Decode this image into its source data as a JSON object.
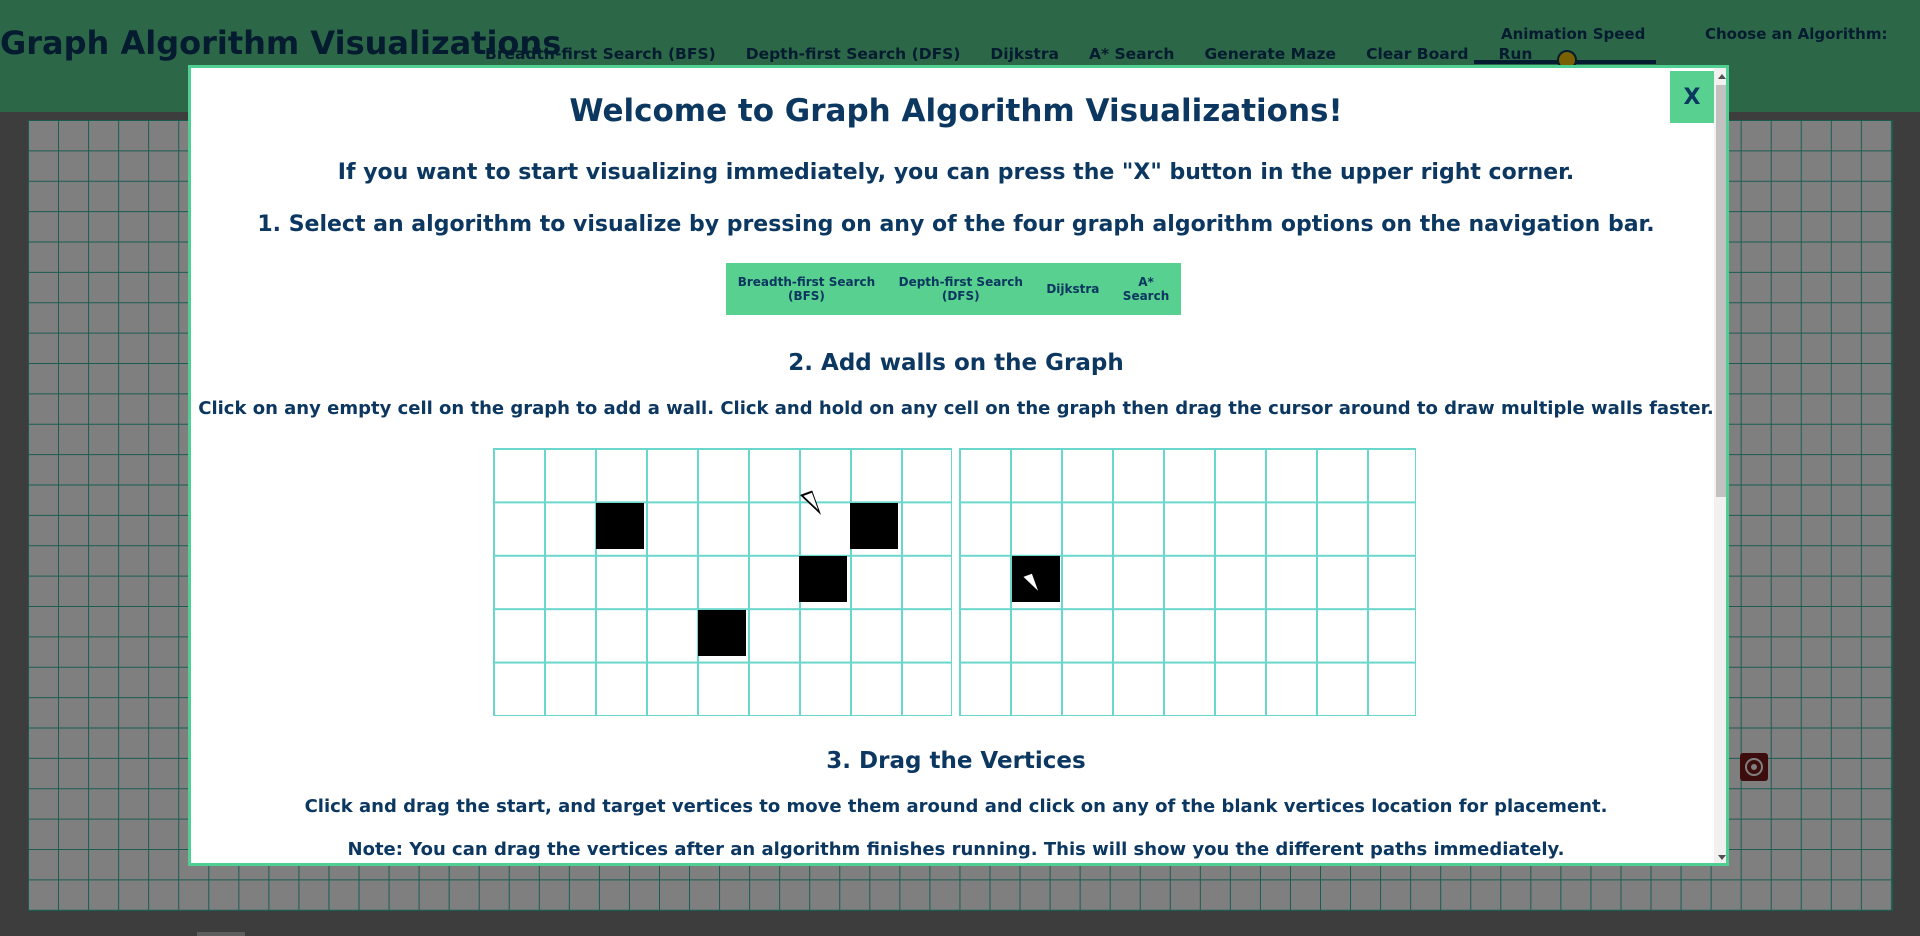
{
  "app": {
    "title": "Graph Algorithm Visualizations",
    "nav": [
      "Breadth-first Search (BFS)",
      "Depth-first Search (DFS)",
      "Dijkstra",
      "A* Search",
      "Generate Maze",
      "Clear Board",
      "Run"
    ],
    "speed_label": "Animation Speed",
    "algo_label": "Choose an Algorithm:"
  },
  "modal": {
    "close_label": "X",
    "welcome": "Welcome to Graph Algorithm Visualizations!",
    "intro": "If you want to start visualizing immediately, you can press the \"X\" button in the upper right corner.",
    "step1": "1. Select an algorithm to visualize by pressing on any of the four graph algorithm options on the navigation bar.",
    "mini_nav": {
      "bfs_line1": "Breadth-first Search",
      "bfs_line2": "(BFS)",
      "dfs_line1": "Depth-first Search",
      "dfs_line2": "(DFS)",
      "dijkstra": "Dijkstra",
      "astar_line1": "A*",
      "astar_line2": "Search"
    },
    "step2_title": "2. Add walls on the Graph",
    "step2_desc": "Click on any empty cell on the graph to add a wall. Click and hold on any cell on the graph then drag the cursor around to draw multiple walls faster.",
    "step3_title": "3. Drag the Vertices",
    "step3_desc": "Click and drag the start, and target vertices to move them around and click on any of the blank vertices location for placement.",
    "note": "Note: You can drag the vertices after an algorithm finishes running. This will show you the different paths immediately."
  },
  "colors": {
    "navbar": "#58d08f",
    "text": "#0b3760",
    "grid_line": "#34b8a5",
    "modal_border": "#4fcf91"
  }
}
